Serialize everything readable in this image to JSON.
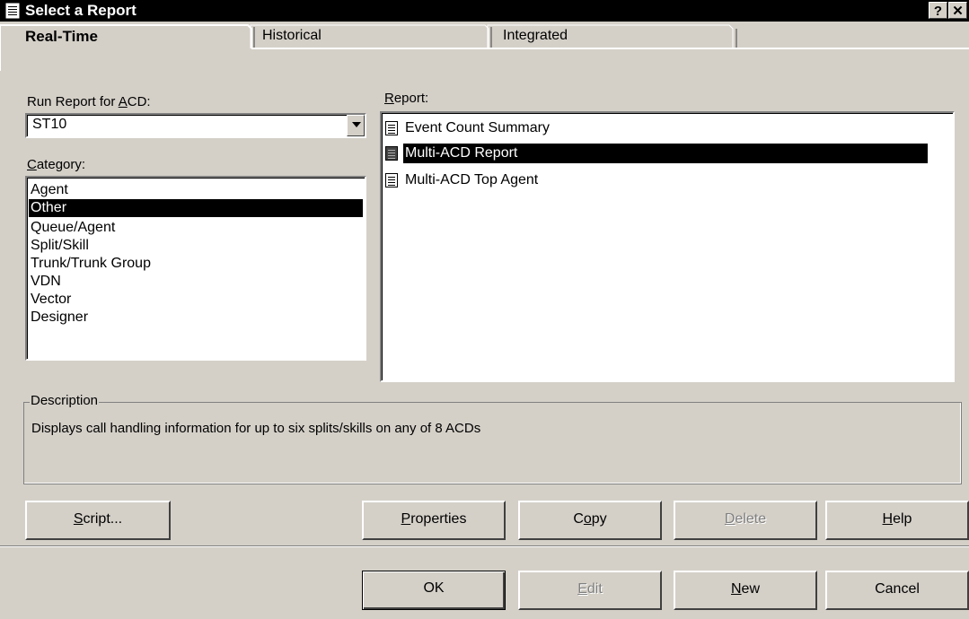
{
  "window": {
    "title": "Select a Report",
    "help_button": "?",
    "close_button": "✕"
  },
  "tabs": [
    {
      "label": "Real-Time",
      "active": true
    },
    {
      "label": "Historical",
      "active": false
    },
    {
      "label": "Integrated",
      "active": false
    }
  ],
  "run_for": {
    "label_pre": "Run Report for ",
    "label_key": "A",
    "label_post": "CD:",
    "value": "ST10"
  },
  "category": {
    "label_key": "C",
    "label_post": "ategory:",
    "items": [
      "Agent",
      "Other",
      "Queue/Agent",
      "Split/Skill",
      "Trunk/Trunk Group",
      "VDN",
      "Vector",
      "Designer"
    ],
    "selected": "Other"
  },
  "report": {
    "label_key": "R",
    "label_post": "eport:",
    "items": [
      "Event Count Summary",
      "Multi-ACD Report",
      "Multi-ACD Top Agent"
    ],
    "selected": "Multi-ACD Report"
  },
  "description": {
    "title": "Description",
    "text": "Displays call handling information for up to six splits/skills on any of 8 ACDs"
  },
  "buttons_row1": {
    "script": {
      "key": "S",
      "rest": "cript..."
    },
    "properties": {
      "key": "P",
      "rest": "roperties"
    },
    "copy": {
      "pre": "C",
      "key": "o",
      "rest": "py"
    },
    "delete": {
      "key": "D",
      "rest": "elete"
    },
    "help": {
      "key": "H",
      "rest": "elp"
    }
  },
  "buttons_row2": {
    "ok": "OK",
    "edit": {
      "key": "E",
      "rest": "dit"
    },
    "new": {
      "key": "N",
      "rest": "ew"
    },
    "cancel": "Cancel"
  },
  "colors": {
    "face": "#d4d0c8",
    "titlebar": "#000000",
    "selection": "#000000"
  },
  "icons": [
    "report-document-icon"
  ]
}
